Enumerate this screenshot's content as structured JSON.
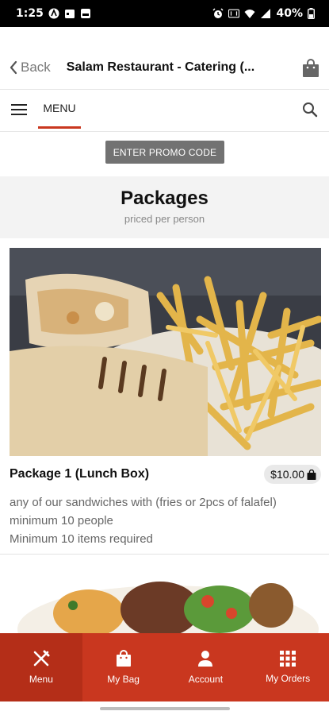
{
  "status_bar": {
    "time": "1:25",
    "battery": "40%"
  },
  "header": {
    "back_label": "Back",
    "title": "Salam Restaurant - Catering (..."
  },
  "menu_bar": {
    "tab_label": "MENU"
  },
  "promo": {
    "button_label": "ENTER PROMO CODE"
  },
  "section": {
    "title": "Packages",
    "subtitle": "priced per person"
  },
  "items": [
    {
      "name": "Package 1 (Lunch Box)",
      "price": "$10.00",
      "description": [
        "any of our sandwiches with (fries or 2pcs of falafel)",
        "minimum 10 people",
        "Minimum 10 items required"
      ]
    }
  ],
  "bottom_nav": {
    "items": [
      {
        "label": "Menu",
        "icon": "fork-knife-icon"
      },
      {
        "label": "My Bag",
        "icon": "bag-icon"
      },
      {
        "label": "Account",
        "icon": "person-icon"
      },
      {
        "label": "My Orders",
        "icon": "grid-icon"
      }
    ]
  },
  "colors": {
    "accent": "#c9371f",
    "promo_bg": "#727272",
    "section_bg": "#f3f3f3"
  }
}
